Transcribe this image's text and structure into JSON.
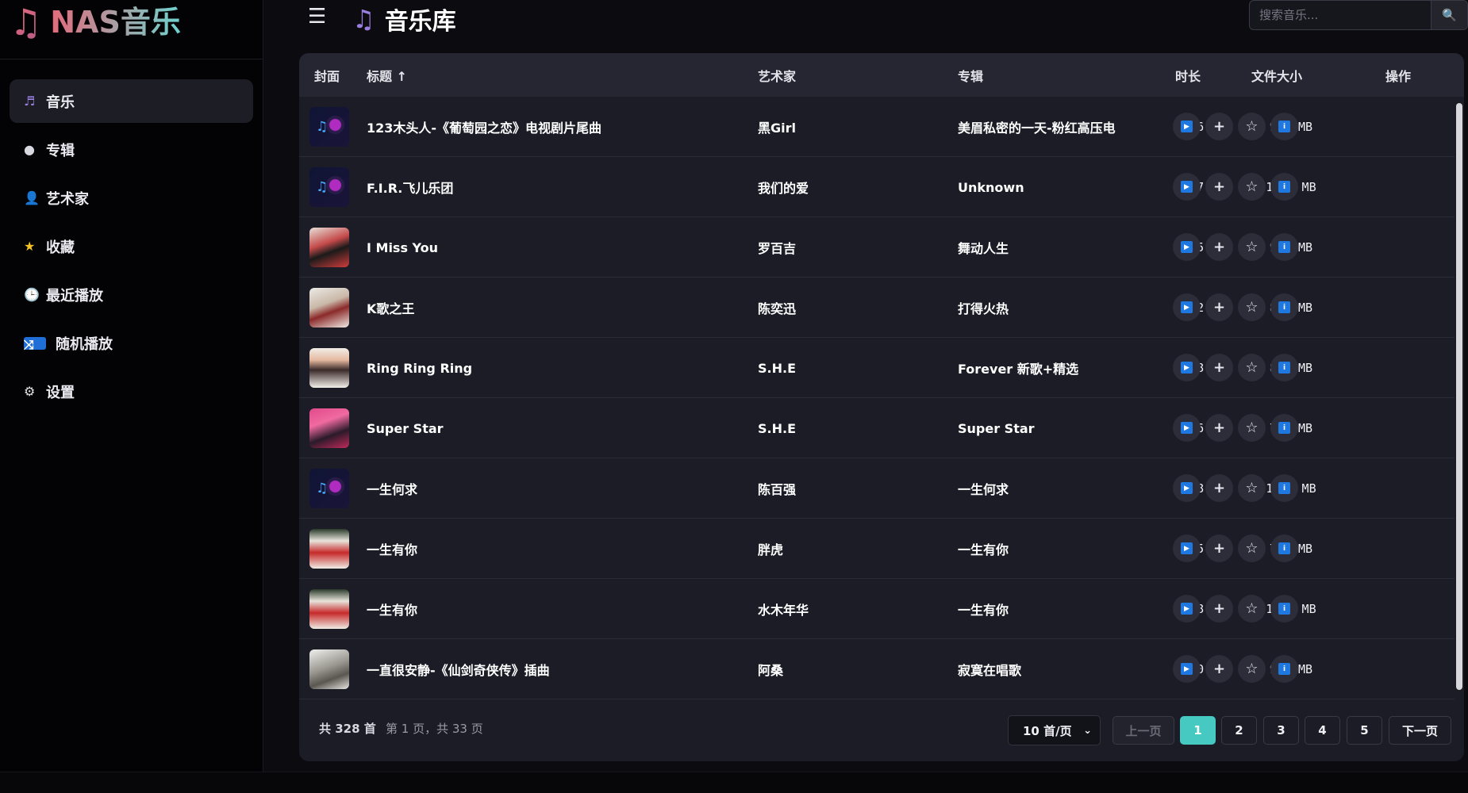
{
  "app": {
    "logo_icon": "music-note-icon",
    "brand": "NAS音乐"
  },
  "sidebar": {
    "items": [
      {
        "label": "音乐",
        "icon": "music-note-icon",
        "glyph": "♬",
        "active": true
      },
      {
        "label": "专辑",
        "icon": "disc-icon",
        "glyph": "●",
        "active": false
      },
      {
        "label": "艺术家",
        "icon": "person-icon",
        "glyph": "👤",
        "active": false
      },
      {
        "label": "收藏",
        "icon": "star-icon",
        "glyph": "★",
        "active": false
      },
      {
        "label": "最近播放",
        "icon": "clock-icon",
        "glyph": "🕒",
        "active": false
      },
      {
        "label": "随机播放",
        "icon": "shuffle-icon",
        "glyph": "⤨",
        "active": false
      },
      {
        "label": "设置",
        "icon": "gear-icon",
        "glyph": "⚙",
        "active": false
      }
    ]
  },
  "header": {
    "menu_glyph": "☰",
    "title_glyph": "♫",
    "title": "音乐库",
    "search_placeholder": "搜索音乐...",
    "search_glyph": "🔍"
  },
  "table": {
    "columns": {
      "cover": "封面",
      "title": "标题 ↑",
      "artist": "艺术家",
      "album": "专辑",
      "duration": "时长",
      "size": "文件大小",
      "actions": "操作"
    },
    "rows": [
      {
        "cover": "default",
        "title": "123木头人-《葡萄园之恋》电视剧片尾曲",
        "artist": "黑Girl",
        "album": "美眉私密的一天-粉红高压电",
        "duration": "3:56",
        "size": "9.0 MB"
      },
      {
        "cover": "default",
        "title": "F.I.R.飞儿乐团",
        "artist": "我们的爱",
        "album": "Unknown",
        "duration": "4:47",
        "size": "11.0 MB"
      },
      {
        "cover": "photo-a",
        "title": "I Miss You",
        "artist": "罗百吉",
        "album": "舞动人生",
        "duration": "4:05",
        "size": "9.4 MB"
      },
      {
        "cover": "photo-b",
        "title": "K歌之王",
        "artist": "陈奕迅",
        "album": "打得火热",
        "duration": "3:42",
        "size": "8.8 MB"
      },
      {
        "cover": "photo-c",
        "title": "Ring Ring Ring",
        "artist": "S.H.E",
        "album": "Forever 新歌+精选",
        "duration": "3:48",
        "size": "8.8 MB"
      },
      {
        "cover": "photo-d",
        "title": "Super Star",
        "artist": "S.H.E",
        "album": "Super Star",
        "duration": "3:16",
        "size": "7.6 MB"
      },
      {
        "cover": "default",
        "title": "一生何求",
        "artist": "陈百强",
        "album": "一生何求",
        "duration": "4:48",
        "size": "11.0 MB"
      },
      {
        "cover": "photo-e",
        "title": "一生有你",
        "artist": "胖虎",
        "album": "一生有你",
        "duration": "3:15",
        "size": "7.8 MB"
      },
      {
        "cover": "photo-e",
        "title": "一生有你",
        "artist": "水木年华",
        "album": "一生有你",
        "duration": "4:18",
        "size": "10.2 MB"
      },
      {
        "cover": "photo-f",
        "title": "一直很安静-《仙剑奇侠传》插曲",
        "artist": "阿桑",
        "album": "寂寞在唱歌",
        "duration": "4:10",
        "size": "9.6 MB"
      }
    ],
    "row_actions": [
      {
        "name": "play-button",
        "icon": "play-icon",
        "glyph": "▶"
      },
      {
        "name": "add-to-playlist-button",
        "icon": "plus-icon",
        "glyph": "+"
      },
      {
        "name": "favorite-button",
        "icon": "star-outline-icon",
        "glyph": "☆"
      },
      {
        "name": "info-button",
        "icon": "info-icon",
        "glyph": "i"
      }
    ]
  },
  "footer": {
    "total": "共 328 首",
    "page_info": "第 1 页，共 33 页",
    "per_page": "10 首/页",
    "prev": "上一页",
    "pages": [
      "1",
      "2",
      "3",
      "4",
      "5"
    ],
    "current_page": "1",
    "next": "下一页"
  },
  "colors": {
    "accent": "#46c9c1",
    "panel": "#1c1c27",
    "sidebar": "#030305",
    "action_blue": "#1e78e0"
  }
}
